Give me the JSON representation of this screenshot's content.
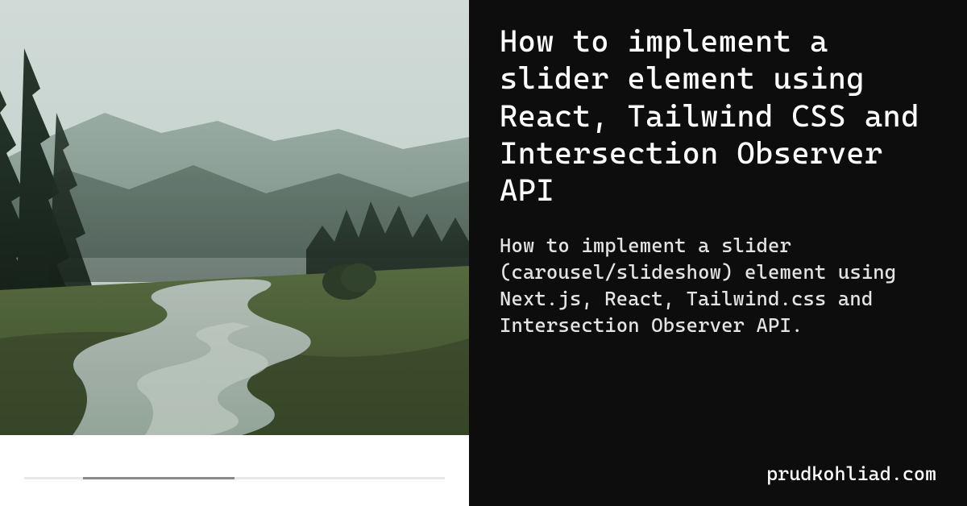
{
  "article": {
    "title": "How to implement a slider element using React, Tailwind CSS and Intersection Observer API",
    "description": "How to implement a slider (carousel/slideshow) element using Next.js, React, Tailwind.css and Intersection Observer API.",
    "domain": "prudkohliad.com"
  },
  "colors": {
    "panel_bg": "#0d0d0d",
    "text_primary": "#ffffff",
    "text_secondary": "#e4e4e4",
    "left_bg": "#ffffff",
    "progress_track": "#e8e8e8",
    "progress_fill": "#8a8a8a"
  }
}
